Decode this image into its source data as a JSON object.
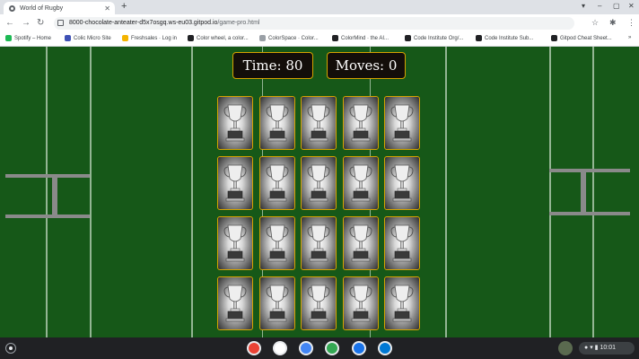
{
  "browser": {
    "tab": {
      "title": "World of Rugby"
    },
    "address": {
      "host": "8000-chocolate-anteater-d5x7osgq.ws-eu03.gitpod.io",
      "path": "/game-pro.html"
    },
    "bookmarks": [
      {
        "label": "Spotify – Home",
        "color": "#1db954"
      },
      {
        "label": "Colic Micro Site",
        "color": "#3f51b5"
      },
      {
        "label": "Freshsales · Log in",
        "color": "#f4b400"
      },
      {
        "label": "Color wheel, a color...",
        "color": "#202124"
      },
      {
        "label": "ColorSpace · Color...",
        "color": "#9aa0a6"
      },
      {
        "label": "ColorMind · the AI...",
        "color": "#202124"
      },
      {
        "label": "Code Institute Org/...",
        "color": "#202124"
      },
      {
        "label": "Code Institute Sub...",
        "color": "#202124"
      },
      {
        "label": "Gitpod Cheat Sheet...",
        "color": "#202124"
      }
    ]
  },
  "game": {
    "time_label": "Time: 80",
    "moves_label": "Moves: 0",
    "card_icon": "trophy-icon"
  },
  "shelf": {
    "clock": "10:01",
    "apps": [
      {
        "name": "chrome-icon",
        "color": "#ea4335"
      },
      {
        "name": "gmail-icon",
        "color": "#ffffff"
      },
      {
        "name": "docs-icon",
        "color": "#4285f4"
      },
      {
        "name": "play-store-icon",
        "color": "#34a853"
      },
      {
        "name": "files-icon",
        "color": "#1a73e8"
      },
      {
        "name": "outlook-icon",
        "color": "#0078d4"
      }
    ]
  },
  "colors": {
    "pitch": "#165818",
    "card_border": "#d6a300",
    "stat_bg": "#130e0a"
  }
}
